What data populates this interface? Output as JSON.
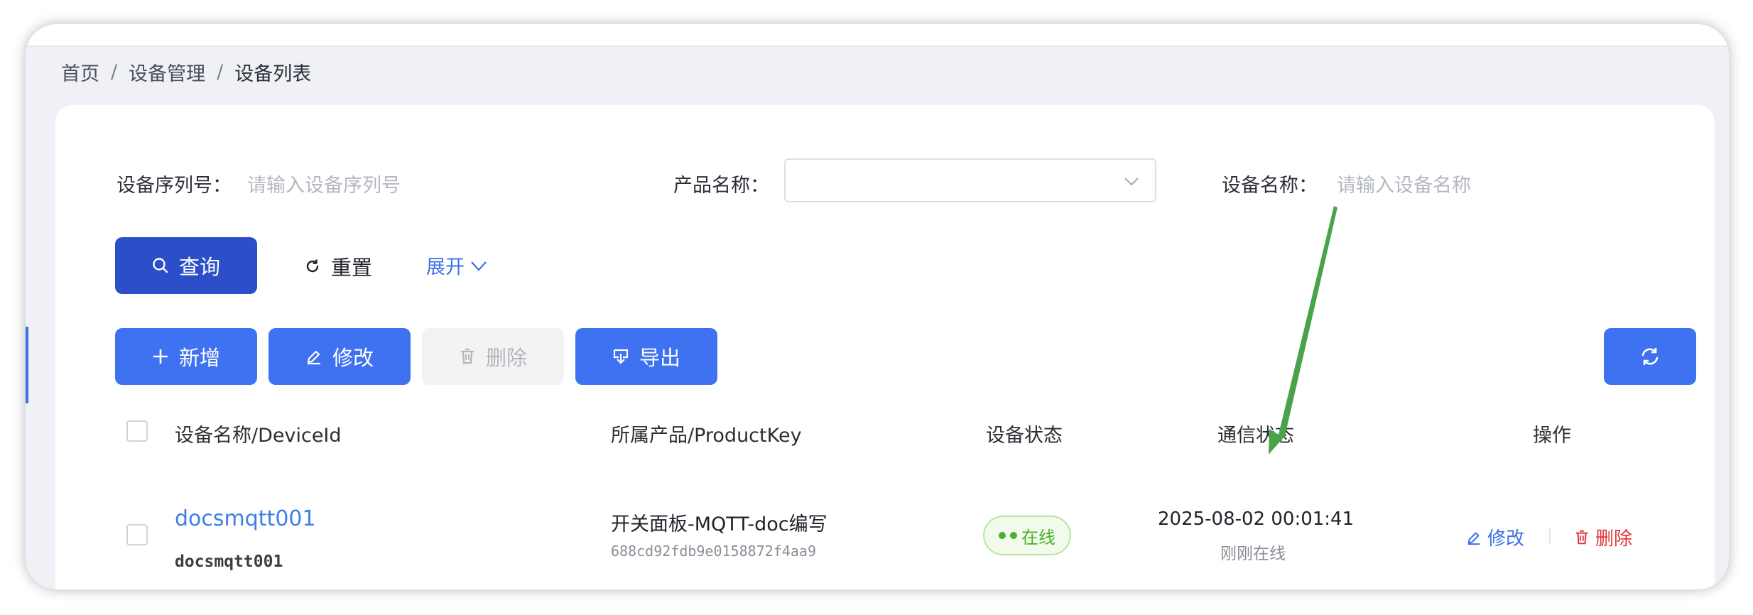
{
  "breadcrumb": {
    "home": "首页",
    "sep1": "/",
    "section": "设备管理",
    "sep2": "/",
    "current": "设备列表"
  },
  "filters": {
    "serial_label": "设备序列号：",
    "serial_placeholder": "请输入设备序列号",
    "product_label": "产品名称：",
    "product_value": "",
    "name_label": "设备名称：",
    "name_placeholder": "请输入设备名称"
  },
  "search_actions": {
    "query": "查询",
    "reset": "重置",
    "expand": "展开"
  },
  "toolbar": {
    "add": "新增",
    "edit": "修改",
    "delete": "删除",
    "export": "导出"
  },
  "table": {
    "headers": {
      "name": "设备名称/DeviceId",
      "product": "所属产品/ProductKey",
      "status": "设备状态",
      "comm": "通信状态",
      "ops": "操作"
    },
    "rows": [
      {
        "name": "docsmqtt001",
        "device_id": "docsmqtt001",
        "product": "开关面板-MQTT-doc编写",
        "product_key": "688cd92fdb9e0158872f4aa9",
        "status": "在线",
        "comm_time": "2025-08-02 00:01:41",
        "comm_note": "刚刚在线",
        "edit": "修改",
        "delete": "删除"
      }
    ]
  },
  "colors": {
    "primary": "#3f72f1",
    "primary_dark": "#2c4fc9",
    "success": "#4fae2f",
    "danger": "#e0383e",
    "annotation_arrow": "#4aa34a"
  },
  "icons": [
    "search-icon",
    "reset-icon",
    "chevron-down-icon",
    "plus-icon",
    "edit-icon",
    "trash-icon",
    "export-icon",
    "refresh-icon"
  ]
}
